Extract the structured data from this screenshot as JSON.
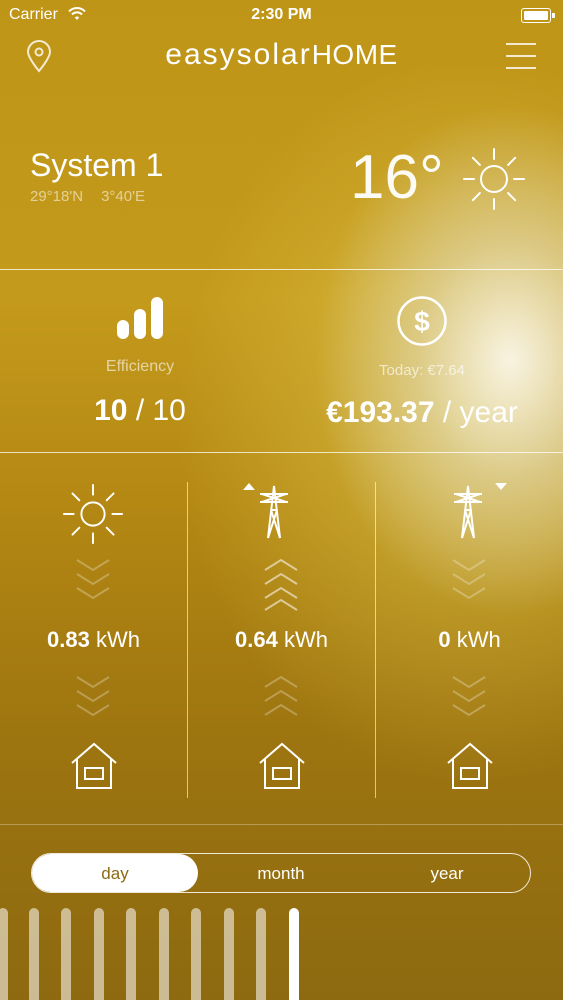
{
  "status_bar": {
    "carrier": "Carrier",
    "time": "2:30 PM"
  },
  "header": {
    "brand_part1": "easysolar",
    "brand_part2": "HOME"
  },
  "system": {
    "name": "System 1",
    "lat": "29°18'N",
    "lon": "3°40'E",
    "temperature": "16°"
  },
  "efficiency": {
    "label": "Efficiency",
    "value": "10",
    "max": "/ 10"
  },
  "savings": {
    "today_label": "Today: €7.64",
    "value": "€193.37",
    "unit": "/ year"
  },
  "flows": [
    {
      "value": "0.83",
      "unit": "kWh"
    },
    {
      "value": "0.64",
      "unit": "kWh"
    },
    {
      "value": "0",
      "unit": "kWh"
    }
  ],
  "period_tabs": {
    "day": "day",
    "month": "month",
    "year": "year",
    "selected": "day"
  }
}
